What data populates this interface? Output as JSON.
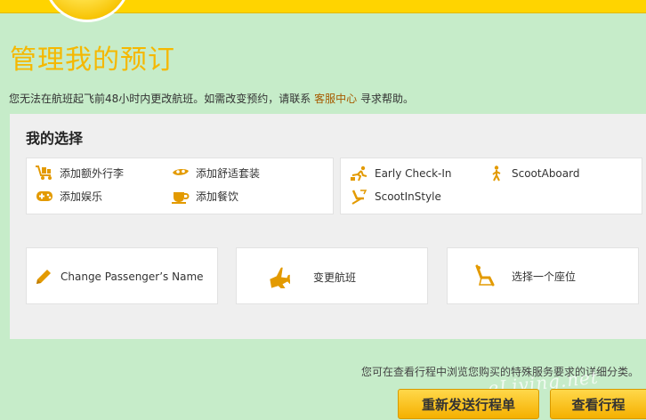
{
  "header": {
    "title": "管理我的预订"
  },
  "notice": {
    "text_before": "您无法在航班起飞前48小时内更改航班。如需改变预约，请联系",
    "link": "客服中心",
    "text_after": "寻求帮助。"
  },
  "panel": {
    "title": "我的选择",
    "addons": [
      {
        "label": "添加额外行李",
        "icon": "luggage-cart-icon"
      },
      {
        "label": "添加舒适套装",
        "icon": "eye-mask-icon"
      },
      {
        "label": "添加娱乐",
        "icon": "gamepad-icon"
      },
      {
        "label": "添加餐饮",
        "icon": "coffee-cup-icon"
      }
    ],
    "services": [
      {
        "label": "Early Check-In",
        "icon": "running-person-icon"
      },
      {
        "label": "ScootAboard",
        "icon": "walking-person-icon"
      },
      {
        "label": "ScootInStyle",
        "icon": "seat-upgrade-icon"
      }
    ],
    "actions": [
      {
        "label": "Change Passenger’s Name",
        "icon": "pencil-icon"
      },
      {
        "label": "变更航班",
        "icon": "airplane-icon"
      },
      {
        "label": "选择一个座位",
        "icon": "seat-icon"
      }
    ]
  },
  "footer": {
    "text": "您可在查看行程中浏览您购买的特殊服务要求的详细分类。",
    "resend_button": "重新发送行程单",
    "view_button": "查看行程"
  },
  "watermark": "eLiving.net",
  "colors": {
    "background": "#c6ecc9",
    "accent": "#f5b800",
    "icon": "#e39a00",
    "link": "#a65a00"
  }
}
